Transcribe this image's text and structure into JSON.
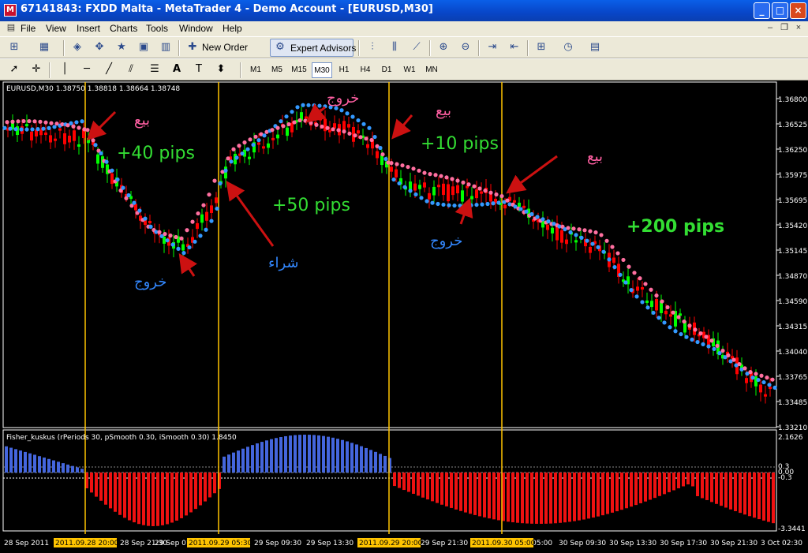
{
  "window": {
    "title": "67141843: FXDD Malta - MetaTrader 4 - Demo Account - [EURUSD,M30]",
    "app_icon": "metatrader-icon",
    "minimize": "_",
    "maximize": "□",
    "close": "×"
  },
  "menu": {
    "items": [
      "File",
      "View",
      "Insert",
      "Charts",
      "Tools",
      "Window",
      "Help"
    ]
  },
  "toolbar": {
    "new_order_label": "New Order",
    "expert_advisors_label": "Expert Advisors",
    "text_tool": "A",
    "timeframes": [
      "M1",
      "M5",
      "M15",
      "M30",
      "H1",
      "H4",
      "D1",
      "W1",
      "MN"
    ],
    "active_timeframe": "M30"
  },
  "chart": {
    "header": "EURUSD,M30  1.38750 1.38818 1.38664 1.38748",
    "colors": {
      "bull": "#00ff00",
      "bear": "#ff0000",
      "dots_pink": "#ff6fa0",
      "dots_blue": "#3399ff",
      "vline": "#ffc400",
      "annot_green": "#33dd33",
      "annot_pink": "#ff5fa2",
      "annot_blue": "#3388ff",
      "arrow": "#cc1111"
    },
    "price_labels": [
      "1.36800",
      "1.36525",
      "1.36250",
      "1.35975",
      "1.35695",
      "1.35420",
      "1.35145",
      "1.34870",
      "1.34590",
      "1.34315",
      "1.34040",
      "1.33765",
      "1.33485",
      "1.33210"
    ],
    "price_range": [
      1.3321,
      1.3695
    ],
    "annotations": [
      {
        "id": "sell-1",
        "text": "بيع",
        "color": "pink"
      },
      {
        "id": "pips-40",
        "text": "+40 pips",
        "color": "green"
      },
      {
        "id": "exit-1",
        "text": "خروج",
        "color": "blue"
      },
      {
        "id": "buy-1",
        "text": "شراء",
        "color": "blue"
      },
      {
        "id": "pips-50",
        "text": "+50 pips",
        "color": "green"
      },
      {
        "id": "exit-2",
        "text": "خروج",
        "color": "pink"
      },
      {
        "id": "sell-2",
        "text": "بيع",
        "color": "pink"
      },
      {
        "id": "pips-10",
        "text": "+10 pips",
        "color": "green"
      },
      {
        "id": "exit-3",
        "text": "خروج",
        "color": "blue"
      },
      {
        "id": "sell-3",
        "text": "بيع",
        "color": "pink"
      },
      {
        "id": "pips-200",
        "text": "+200 pips",
        "color": "green"
      }
    ]
  },
  "indicator": {
    "header": "Fisher_kuskus  (rPeriods 30, pSmooth 0.30, iSmooth 0.30)   1.8450",
    "scale_labels": [
      "2.1626",
      "0.3",
      "0.00",
      "-0.3",
      "-3.3441"
    ],
    "range": [
      -3.3441,
      2.1626
    ]
  },
  "time_axis": {
    "labels": [
      "28 Sep 2011",
      "28 Sep 21:30",
      "29 Sep 01:30",
      "29 Sep 09:30",
      "29 Sep 13:30",
      "29 Sep 21:30",
      "30 Sep 05:00",
      "30 Sep 09:30",
      "30 Sep 13:30",
      "30 Sep 17:30",
      "30 Sep 21:30",
      "3 Oct 02:30"
    ],
    "highlighted": [
      "2011.09.28 20:00",
      "2011.09.29 05:30",
      "2011.09.29 20:00",
      "2011.09.30 05:00"
    ]
  }
}
